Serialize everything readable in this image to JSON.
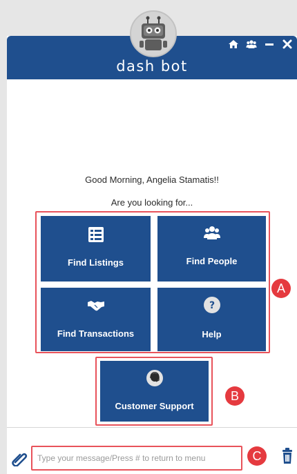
{
  "header": {
    "title": "dash bot",
    "icons": [
      "home-icon",
      "group-icon",
      "minimize-icon",
      "close-icon"
    ]
  },
  "main": {
    "greeting": "Good Morning, Angelia Stamatis!!",
    "question": "Are you looking for...",
    "tiles": [
      {
        "label": "Find Listings",
        "icon": "listings-icon"
      },
      {
        "label": "Find People",
        "icon": "people-icon"
      },
      {
        "label": "Find Transactions",
        "icon": "handshake-icon"
      },
      {
        "label": "Help",
        "icon": "help-icon"
      },
      {
        "label": "Customer Support",
        "icon": "support-icon"
      }
    ]
  },
  "annotations": {
    "a": "A",
    "b": "B",
    "c": "C"
  },
  "footer": {
    "input_placeholder": "Type your message/Press # to return to menu"
  },
  "colors": {
    "brand": "#1f4f8e",
    "highlight": "#e8525a",
    "badge": "#e53a3f"
  }
}
